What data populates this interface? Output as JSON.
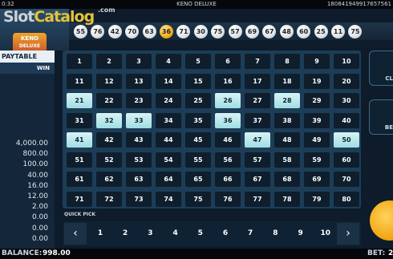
{
  "status_bar": {
    "time": "0:32",
    "title": "KENO DELUXE",
    "session_id": "180841949917657561"
  },
  "watermark": {
    "slot": "Slot",
    "catalog": "Catalog",
    "com": ".com"
  },
  "logo": {
    "line1": "KENO",
    "line2": "DELUXE"
  },
  "drawn_balls": [
    {
      "n": "55",
      "gold": false
    },
    {
      "n": "76",
      "gold": false
    },
    {
      "n": "42",
      "gold": false
    },
    {
      "n": "70",
      "gold": false
    },
    {
      "n": "63",
      "gold": false
    },
    {
      "n": "36",
      "gold": true
    },
    {
      "n": "71",
      "gold": false
    },
    {
      "n": "30",
      "gold": false
    },
    {
      "n": "75",
      "gold": false
    },
    {
      "n": "57",
      "gold": false
    },
    {
      "n": "69",
      "gold": false
    },
    {
      "n": "67",
      "gold": false
    },
    {
      "n": "48",
      "gold": false
    },
    {
      "n": "60",
      "gold": false
    },
    {
      "n": "25",
      "gold": false
    },
    {
      "n": "11",
      "gold": false
    },
    {
      "n": "75",
      "gold": false
    }
  ],
  "paytable": {
    "title": "PAYTABLE",
    "win_header": "WIN",
    "values": [
      "4,000.00",
      "800.00",
      "100.00",
      "40.00",
      "16.00",
      "12.00",
      "2.00",
      "0.00",
      "0.00",
      "0.00"
    ]
  },
  "board": {
    "numbers": [
      "1",
      "2",
      "3",
      "4",
      "5",
      "6",
      "7",
      "8",
      "9",
      "10",
      "11",
      "12",
      "13",
      "14",
      "15",
      "16",
      "17",
      "18",
      "19",
      "20",
      "21",
      "22",
      "23",
      "24",
      "25",
      "26",
      "27",
      "28",
      "29",
      "30",
      "31",
      "32",
      "33",
      "34",
      "35",
      "36",
      "37",
      "38",
      "39",
      "40",
      "41",
      "42",
      "43",
      "44",
      "45",
      "46",
      "47",
      "48",
      "49",
      "50",
      "51",
      "52",
      "53",
      "54",
      "55",
      "56",
      "57",
      "58",
      "59",
      "60",
      "61",
      "62",
      "63",
      "64",
      "65",
      "66",
      "67",
      "68",
      "69",
      "70",
      "71",
      "72",
      "73",
      "74",
      "75",
      "76",
      "77",
      "78",
      "79",
      "80"
    ],
    "selected": [
      21,
      26,
      28,
      32,
      33,
      36,
      41,
      47,
      50
    ]
  },
  "quick_pick": {
    "label": "QUICK PICK",
    "numbers": [
      "1",
      "2",
      "3",
      "4",
      "5",
      "6",
      "7",
      "8",
      "9",
      "10"
    ],
    "prev_icon": "chevron-left-icon",
    "next_icon": "chevron-right-icon"
  },
  "side_buttons": {
    "clear_label": "CL",
    "bet_label": "BE"
  },
  "footer": {
    "balance_label": "BALANCE:",
    "balance_value": "998.00",
    "bet_label": "BET:",
    "bet_value": "2"
  },
  "colors": {
    "selected_cell": "#b8ebef",
    "gold_ball": "#f2b01d",
    "board_bg": "#1d3d57"
  }
}
